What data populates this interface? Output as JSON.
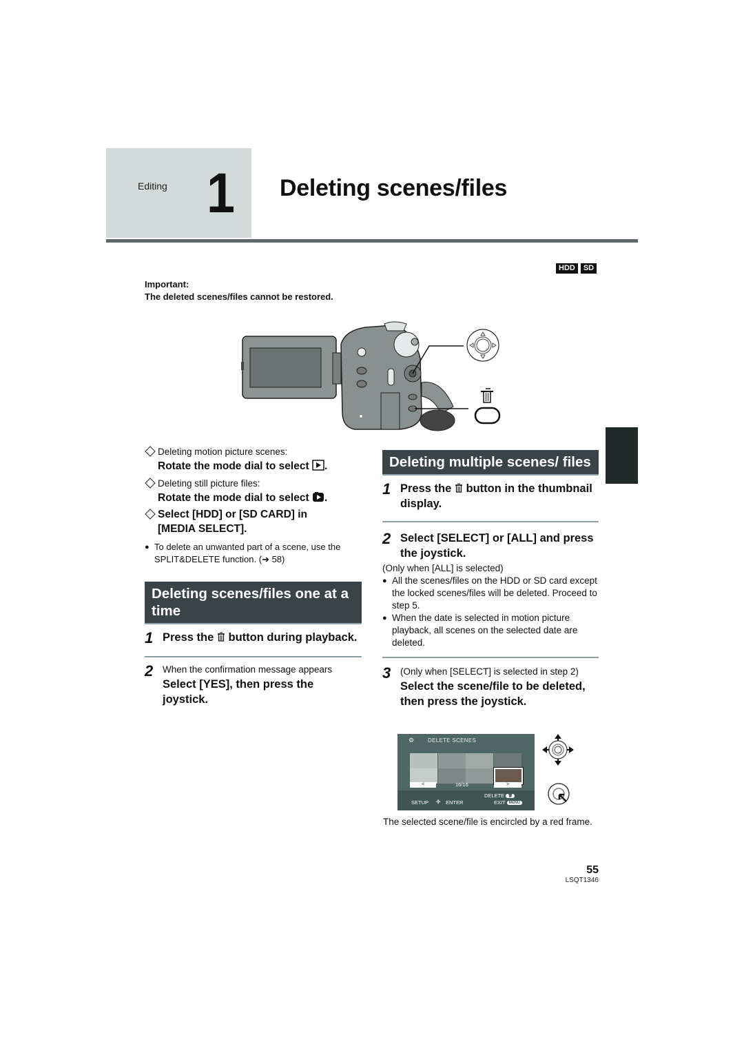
{
  "header": {
    "category": "Editing",
    "chapter_number": "1",
    "title": "Deleting scenes/files"
  },
  "media_badges": [
    "HDD",
    "SD"
  ],
  "important": {
    "label": "Important:",
    "text": "The deleted scenes/files cannot be restored."
  },
  "illustration": {
    "joystick_icon": "joystick-icon",
    "delete_icon": "trash-icon"
  },
  "prep": {
    "motion_label": "Deleting motion picture scenes:",
    "motion_action": "Rotate the mode dial to select",
    "motion_icon": "play-icon",
    "still_label": "Deleting still picture files:",
    "still_action": "Rotate the mode dial to select",
    "still_icon": "still-playback-icon",
    "media_select": "Select [HDD] or [SD CARD] in [MEDIA SELECT].",
    "note": "To delete an unwanted part of a scene, use the SPLIT&DELETE function. (➔ 58)"
  },
  "one_at_a_time": {
    "heading": "Deleting scenes/files one at a time",
    "steps": [
      {
        "num": "1",
        "pre": "Press the",
        "post": "button during playback."
      },
      {
        "num": "2",
        "lead": "When the confirmation message appears",
        "title": "Select [YES], then press the joystick."
      }
    ]
  },
  "multiple": {
    "heading": "Deleting multiple scenes/ files",
    "steps": [
      {
        "num": "1",
        "pre": "Press the",
        "post": "button in the thumbnail display."
      },
      {
        "num": "2",
        "title": "Select [SELECT] or [ALL] and press the joystick.",
        "condition": "(Only when [ALL] is selected)",
        "bullets": [
          "All the scenes/files on the HDD or SD card except the locked scenes/files will be deleted. Proceed to step 5.",
          "When the date is selected in motion picture playback, all scenes on the selected date are deleted."
        ]
      },
      {
        "num": "3",
        "lead": "(Only when [SELECT] is selected in step 2)",
        "title": "Select the scene/file to be deleted, then press the joystick."
      }
    ],
    "screen": {
      "title": "DELETE SCENES",
      "prev": "<",
      "next": ">",
      "counter": "16/16",
      "delete_label": "DELETE",
      "setup_label": "SETUP",
      "enter_label": "ENTER",
      "exit_label": "EXIT",
      "menu_label": "MENU"
    },
    "caption": "The selected scene/file is encircled by a red frame."
  },
  "footer": {
    "page_number": "55",
    "doc_code": "LSQT1346"
  }
}
